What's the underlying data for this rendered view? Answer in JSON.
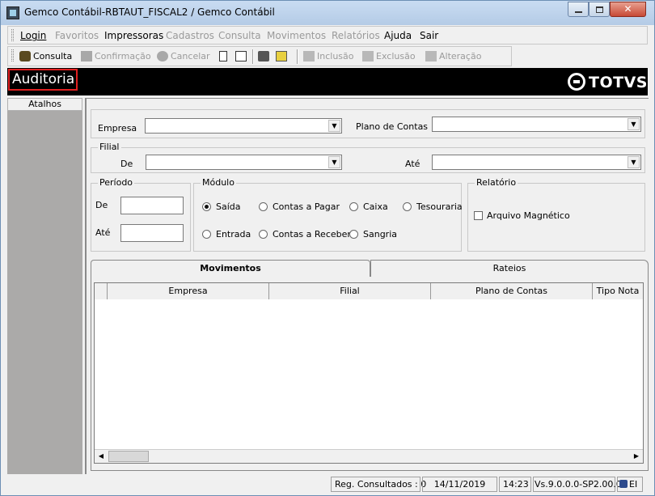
{
  "window": {
    "title": "Gemco Contábil-RBTAUT_FISCAL2 / Gemco Contábil",
    "close_glyph": "✕"
  },
  "menu": [
    "Login",
    "Favoritos",
    "Impressoras",
    "Cadastros",
    "Consulta",
    "Movimentos",
    "Relatórios",
    "Ajuda",
    "Sair"
  ],
  "toolbar": {
    "consulta": "Consulta",
    "confirmacao": "Confirmação",
    "cancelar": "Cancelar",
    "inclusao": "Inclusão",
    "exclusao": "Exclusão",
    "alteracao": "Alteração"
  },
  "banner": {
    "screen_title": "Auditoria",
    "brand": "TOTVS"
  },
  "sidebar": {
    "header": "Atalhos"
  },
  "filters": {
    "empresa_label": "Empresa",
    "plano_label": "Plano de Contas",
    "filial_legend": "Filial",
    "de_label": "De",
    "ate_label": "Até",
    "empresa_value": "",
    "plano_value": "",
    "filial_de_value": "",
    "filial_ate_value": ""
  },
  "periodo": {
    "legend": "Período",
    "de_label": "De",
    "ate_label": "Até",
    "de_value": "",
    "ate_value": ""
  },
  "modulo": {
    "legend": "Módulo",
    "options": [
      "Saída",
      "Contas a Pagar",
      "Caixa",
      "Tesouraria",
      "Entrada",
      "Contas a Receber",
      "Sangria"
    ],
    "selected": "Saída"
  },
  "relatorio": {
    "legend": "Relatório",
    "arquivo_label": "Arquivo Magnético",
    "arquivo_checked": false
  },
  "tabs": [
    "Movimentos",
    "Rateios"
  ],
  "grid": {
    "columns": [
      "Empresa",
      "Filial",
      "Plano de Contas",
      "Tipo Nota"
    ]
  },
  "status": {
    "reg_consultados": "Reg. Consultados : 0",
    "date": "14/11/2019",
    "time": "14:23",
    "version": "Vs.9.0.0.0-SP2.00.0",
    "tray": "EI"
  }
}
